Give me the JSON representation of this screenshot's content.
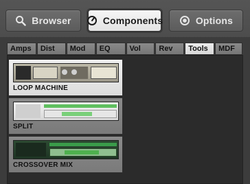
{
  "nav": {
    "browser_label": "Browser",
    "components_label": "Components",
    "options_label": "Options"
  },
  "tabs": [
    {
      "label": "Amps"
    },
    {
      "label": "Dist"
    },
    {
      "label": "Mod"
    },
    {
      "label": "EQ"
    },
    {
      "label": "Vol"
    },
    {
      "label": "Rev"
    },
    {
      "label": "Tools"
    },
    {
      "label": "MDF"
    }
  ],
  "selected_tab": "Tools",
  "components": [
    {
      "label": "LOOP MACHINE"
    },
    {
      "label": "SPLIT"
    },
    {
      "label": "CROSSOVER MIX"
    }
  ],
  "colors": {
    "accent_green": "#5fbf5f",
    "selected_bg": "#e8e8e8"
  }
}
